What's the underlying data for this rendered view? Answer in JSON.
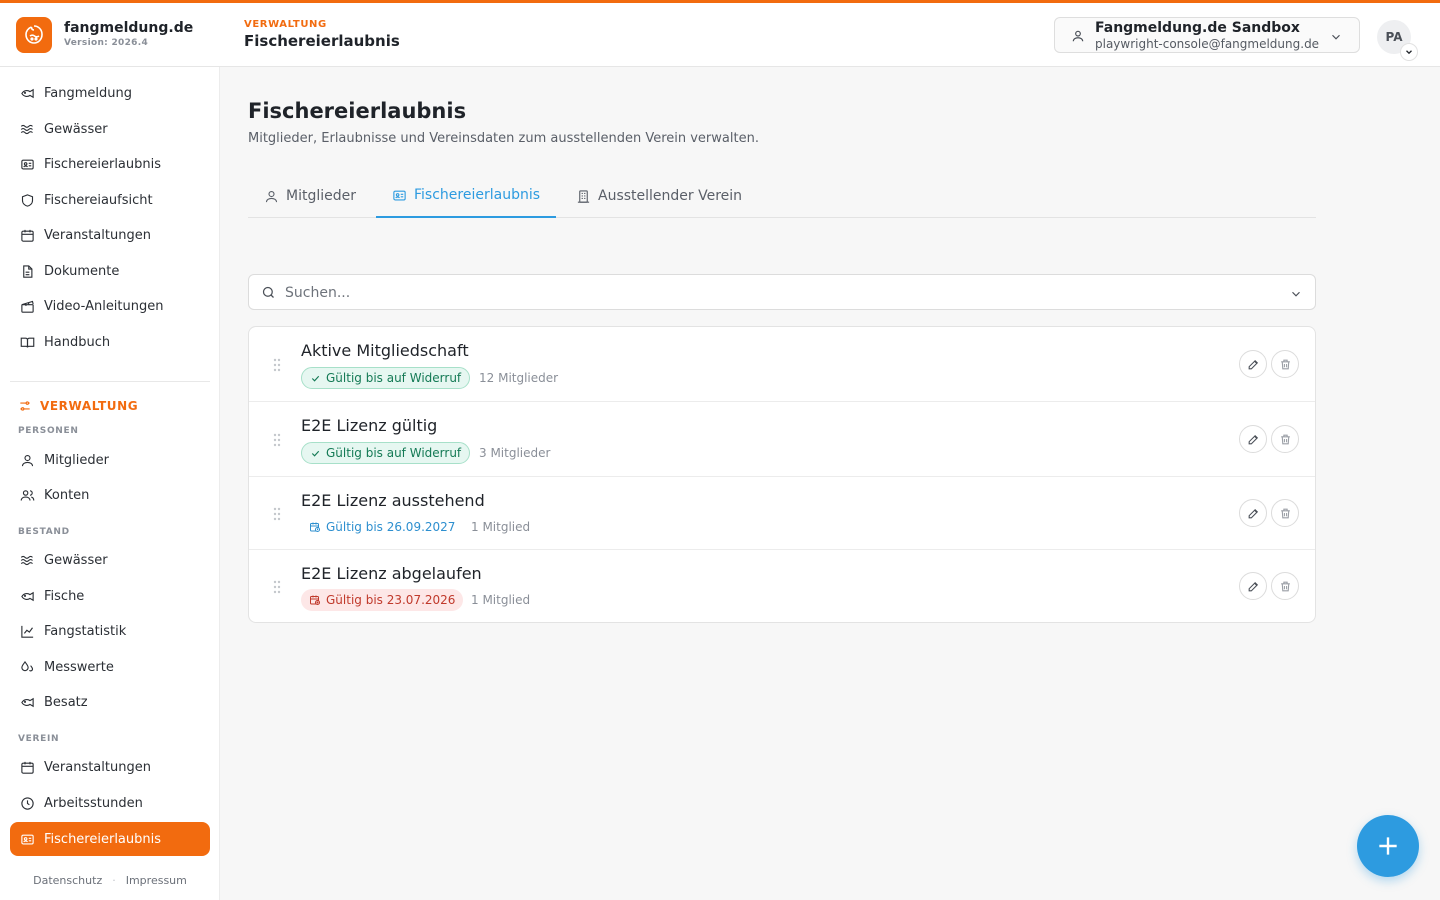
{
  "app": {
    "name": "fangmeldung.de",
    "version": "Version: 2026.4",
    "accent_color": "#f26b0f",
    "link_color": "#2d9be0"
  },
  "header": {
    "kicker": "VERWALTUNG",
    "title": "Fischereierlaubnis",
    "account_name": "Fangmeldung.de Sandbox",
    "account_email": "playwright-console@fangmeldung.de",
    "avatar_initials": "PA"
  },
  "sidebar": {
    "main_items": [
      {
        "label": "Fangmeldung",
        "icon": "fish-icon"
      },
      {
        "label": "Gewässer",
        "icon": "waves-icon"
      },
      {
        "label": "Fischereierlaubnis",
        "icon": "id-card-icon"
      },
      {
        "label": "Fischereiaufsicht",
        "icon": "shield-icon"
      },
      {
        "label": "Veranstaltungen",
        "icon": "calendar-icon"
      },
      {
        "label": "Dokumente",
        "icon": "document-icon"
      },
      {
        "label": "Video-Anleitungen",
        "icon": "clapperboard-icon"
      },
      {
        "label": "Handbuch",
        "icon": "book-icon"
      }
    ],
    "section_title": "VERWALTUNG",
    "groups": {
      "personen": "PERSONEN",
      "bestand": "BESTAND",
      "verein": "VEREIN"
    },
    "personen_items": [
      {
        "label": "Mitglieder",
        "icon": "user-icon"
      },
      {
        "label": "Konten",
        "icon": "users-icon"
      }
    ],
    "bestand_items": [
      {
        "label": "Gewässer",
        "icon": "waves-icon"
      },
      {
        "label": "Fische",
        "icon": "fish-icon"
      },
      {
        "label": "Fangstatistik",
        "icon": "line-chart-icon"
      },
      {
        "label": "Messwerte",
        "icon": "droplets-icon"
      },
      {
        "label": "Besatz",
        "icon": "fish-icon"
      }
    ],
    "verein_items": [
      {
        "label": "Veranstaltungen",
        "icon": "calendar-icon"
      },
      {
        "label": "Arbeitsstunden",
        "icon": "clock-icon"
      },
      {
        "label": "Fischereierlaubnis",
        "icon": "id-card-icon",
        "active": true
      }
    ],
    "footer": {
      "privacy": "Datenschutz",
      "separator": "·",
      "imprint": "Impressum"
    }
  },
  "main": {
    "title": "Fischereierlaubnis",
    "subtitle": "Mitglieder, Erlaubnisse und Vereinsdaten zum ausstellenden Verein verwalten.",
    "tabs": [
      {
        "label": "Mitglieder",
        "icon": "user-icon",
        "active": false
      },
      {
        "label": "Fischereierlaubnis",
        "icon": "id-card-icon",
        "active": true
      },
      {
        "label": "Ausstellender Verein",
        "icon": "building-icon",
        "active": false
      }
    ],
    "search": {
      "placeholder": "Suchen...",
      "value": ""
    },
    "permits": [
      {
        "title": "Aktive Mitgliedschaft",
        "status": "Gültig bis auf Widerruf",
        "status_type": "valid",
        "members": "12 Mitglieder"
      },
      {
        "title": "E2E Lizenz gültig",
        "status": "Gültig bis auf Widerruf",
        "status_type": "valid",
        "members": "3 Mitglieder"
      },
      {
        "title": "E2E Lizenz ausstehend",
        "status": "Gültig bis 26.09.2027",
        "status_type": "pending",
        "members": "1 Mitglied"
      },
      {
        "title": "E2E Lizenz abgelaufen",
        "status": "Gültig bis 23.07.2026",
        "status_type": "expired",
        "members": "1 Mitglied"
      }
    ]
  }
}
